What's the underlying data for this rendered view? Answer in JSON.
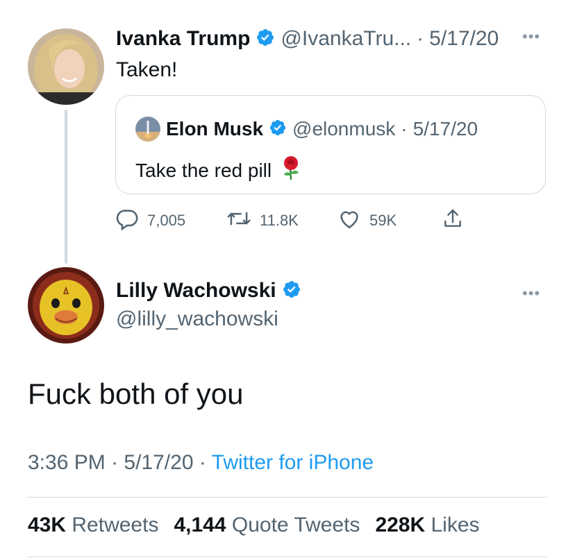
{
  "colors": {
    "text": "#0f1419",
    "secondary": "#536471",
    "verified": "#1d9bf0",
    "link": "#1d9bf0",
    "border": "#cfd9de"
  },
  "parent_tweet": {
    "author_name": "Ivanka Trump",
    "handle": "@IvankaTru...",
    "separator": "·",
    "date": "5/17/20",
    "text": "Taken!",
    "quoted_tweet": {
      "author_name": "Elon Musk",
      "handle": "@elonmusk",
      "separator": "·",
      "date": "5/17/20",
      "text": "Take the red pill",
      "emoji_icon": "rose-icon"
    },
    "actions": {
      "replies": "7,005",
      "retweets": "11.8K",
      "likes": "59K"
    }
  },
  "main_tweet": {
    "author_name": "Lilly Wachowski",
    "handle": "@lilly_wachowski",
    "text": "Fuck both of you",
    "time": "3:36 PM",
    "separator": "·",
    "date": "5/17/20",
    "separator2": "·",
    "source": "Twitter for iPhone",
    "stats": {
      "retweets_count": "43K",
      "retweets_label": "Retweets",
      "quotes_count": "4,144",
      "quotes_label": "Quote Tweets",
      "likes_count": "228K",
      "likes_label": "Likes"
    }
  }
}
